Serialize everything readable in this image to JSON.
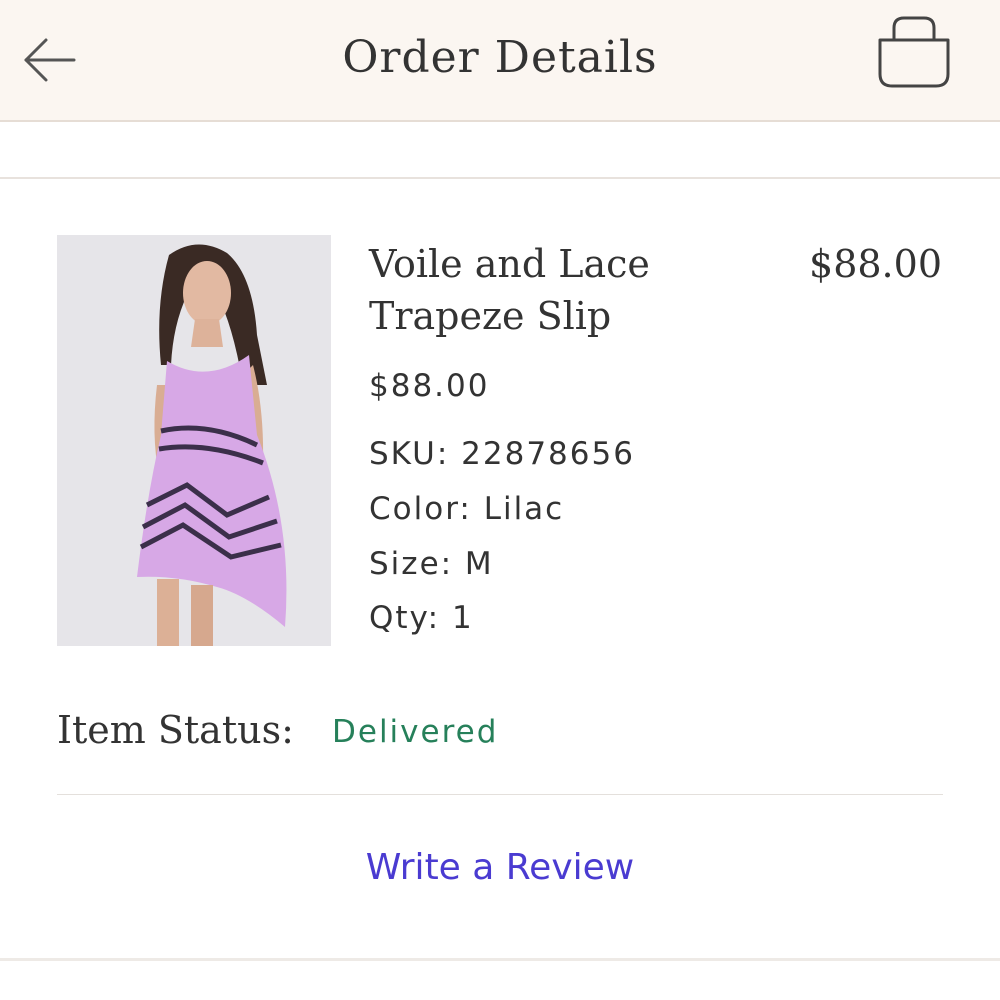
{
  "header": {
    "title": "Order Details",
    "back_icon": "arrow-left-icon",
    "bag_icon": "shopping-bag-icon"
  },
  "item": {
    "name_line1": "Voile and Lace",
    "name_line2": "Trapeze Slip",
    "total_price": "$88.00",
    "unit_price": "$88.00",
    "sku": "SKU: 22878656",
    "color": "Color: Lilac",
    "size": "Size: M",
    "qty": "Qty: 1"
  },
  "status": {
    "label": "Item Status:",
    "value": "Delivered"
  },
  "actions": {
    "review_label": "Write a Review"
  },
  "colors": {
    "header_bg": "#fbf6f1",
    "status_green": "#26805a",
    "link_purple": "#4a3bd1",
    "dress_lilac": "#d7a8e6"
  }
}
